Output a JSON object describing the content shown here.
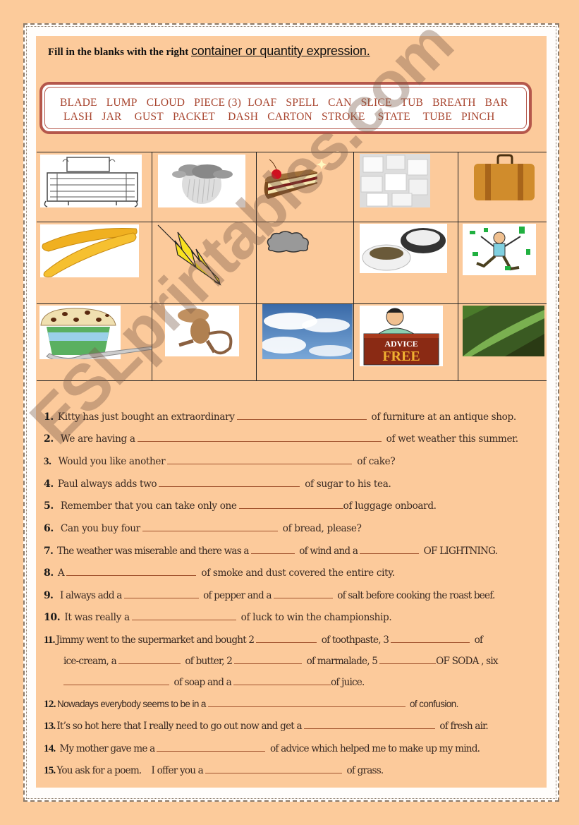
{
  "title": {
    "lead": "Fill in the blanks with the right ",
    "emphasis": "container or quantity expression."
  },
  "word_bank": {
    "row1": [
      "BLADE",
      "LUMP",
      "CLOUD",
      "PIECE (3)",
      "LOAF",
      "SPELL",
      "CAN",
      "SLICE",
      "TUB",
      "BREATH",
      "BAR"
    ],
    "row2": [
      "LASH",
      "JAR",
      "GUST",
      "PACKET",
      "DASH",
      "CARTON",
      "STROKE",
      "STATE",
      "TUBE",
      "PINCH"
    ]
  },
  "pictures": [
    [
      "chest-of-drawers",
      "rain-cloud",
      "cake-slice",
      "sugar-lumps",
      "suitcase"
    ],
    [
      "baguettes",
      "lightning-bolt",
      "smoke-cloud",
      "pepper-and-salt",
      "lucky-man-money"
    ],
    [
      "ice-cream-tub",
      "monkey",
      "sky-clouds",
      "free-advice-stand",
      "grass-blade"
    ]
  ],
  "watermark": "ESLprintables.com",
  "questions": [
    {
      "num": "1.",
      "parts": [
        "Kitty has just bought an extraordinary",
        " of furniture at an antique shop."
      ]
    },
    {
      "num": "2.",
      "parts": [
        "We are having a",
        " of wet weather this summer."
      ]
    },
    {
      "num": "3.",
      "parts": [
        "Would you like another",
        " of cake?"
      ]
    },
    {
      "num": "4.",
      "parts": [
        "Paul always adds two",
        " of sugar to his tea."
      ]
    },
    {
      "num": "5.",
      "parts": [
        "Remember that you can take only one",
        "of luggage onboard."
      ]
    },
    {
      "num": "6.",
      "parts": [
        "Can you buy four",
        " of bread, please?"
      ]
    },
    {
      "num": "7.",
      "parts": [
        "The weather was miserable and there was a",
        " of wind and a",
        " OF LIGHTNING."
      ]
    },
    {
      "num": "8.",
      "parts": [
        "A",
        " of smoke and dust covered the entire city."
      ]
    },
    {
      "num": "9.",
      "parts": [
        "I always add a",
        " of pepper and a",
        " of salt before cooking the roast beef."
      ]
    },
    {
      "num": "10.",
      "parts": [
        "It was really a",
        " of luck to win the championship."
      ]
    },
    {
      "num": "11.",
      "lines": [
        [
          "Jimmy went to the supermarket and bought 2",
          " of toothpaste, 3",
          " of"
        ],
        [
          "ice-cream,  a",
          " of butter, 2",
          " of marmalade, 5",
          "OF SODA , six"
        ],
        [
          "",
          " of soap and a",
          "of juice."
        ]
      ]
    },
    {
      "num": "12.",
      "parts": [
        "Nowadays everybody seems to be in a",
        " of confusion."
      ]
    },
    {
      "num": "13.",
      "parts": [
        "It’s so hot here that I really need to go out now and get a",
        " of fresh air."
      ]
    },
    {
      "num": "14.",
      "parts": [
        "My mother gave me a",
        " of advice which helped me to make up my mind."
      ]
    },
    {
      "num": "15.",
      "parts": [
        "You ask for a poem.    I offer you a",
        " of grass."
      ]
    }
  ]
}
